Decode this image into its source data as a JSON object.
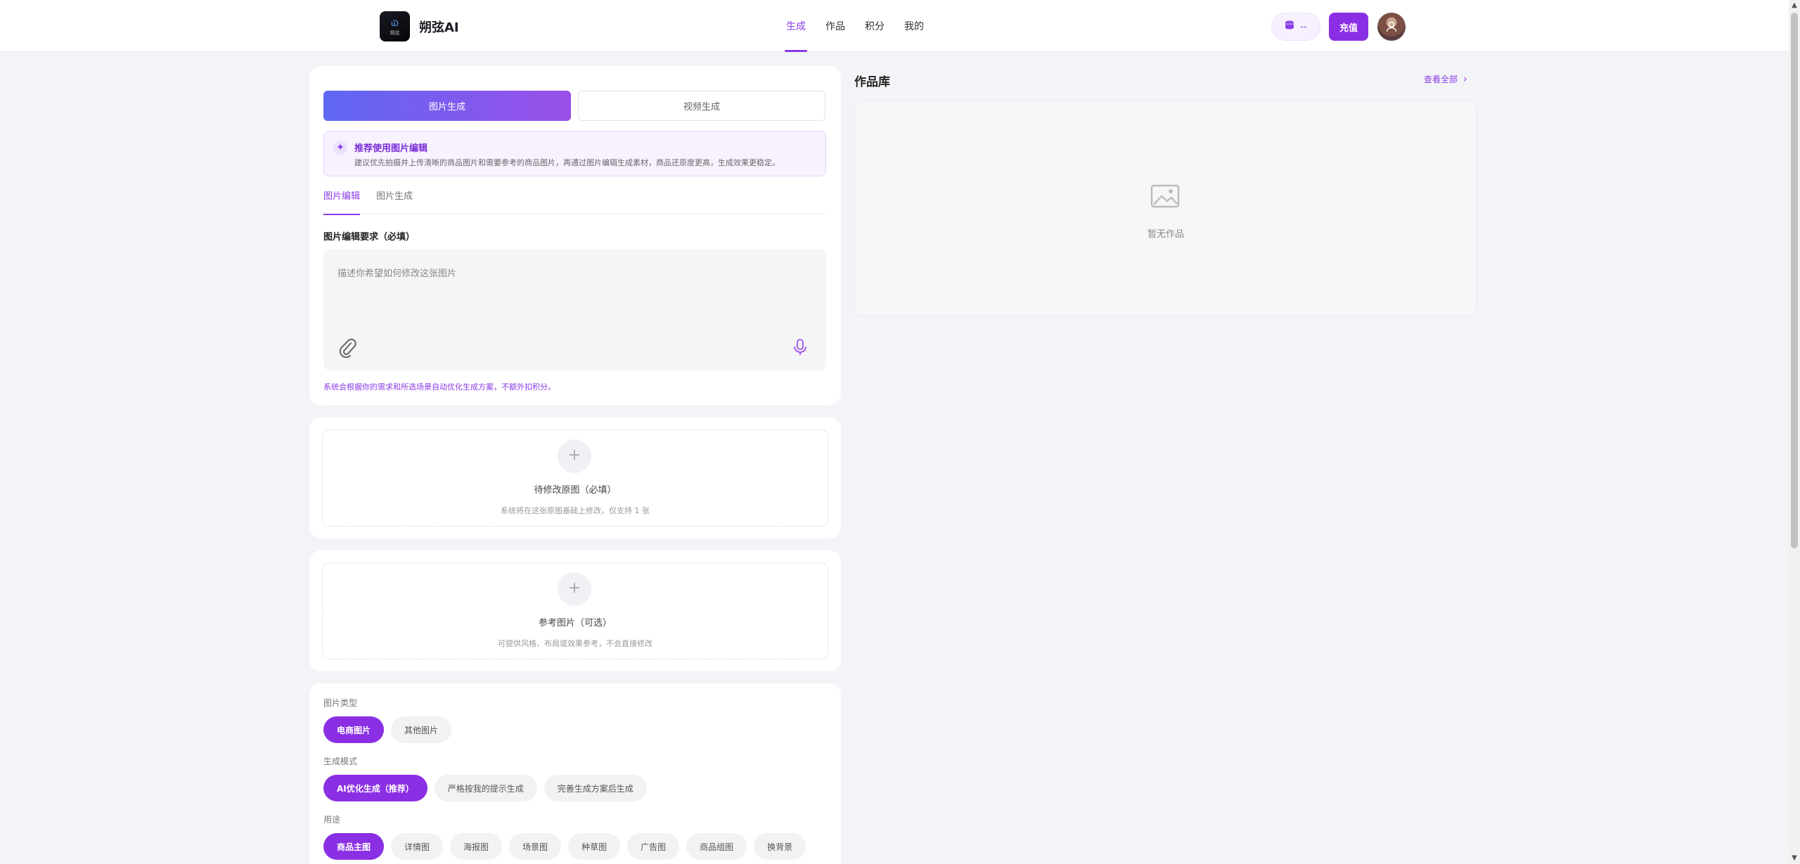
{
  "header": {
    "logo_text": "朔弦",
    "brand": "朔弦AI",
    "nav": [
      "生成",
      "作品",
      "积分",
      "我的"
    ],
    "points": "--",
    "recharge": "充值"
  },
  "generator": {
    "mode_tabs": [
      "图片生成",
      "视频生成"
    ],
    "tip": {
      "title": "推荐使用图片编辑",
      "desc": "建议优先拍摄并上传清晰的商品图片和需要参考的商品图片，再通过图片编辑生成素材，商品还原度更高，生成效果更稳定。"
    },
    "sub_tabs": [
      "图片编辑",
      "图片生成"
    ],
    "field_label": "图片编辑要求（必填）",
    "placeholder": "描述你希望如何修改这张图片",
    "hint": "系统会根据你的需求和所选场景自动优化生成方案，不额外扣积分。"
  },
  "upload_source": {
    "title": "待修改原图（必填）",
    "desc": "系统将在这张原图基础上修改，仅支持 1 张"
  },
  "upload_reference": {
    "title": "参考图片（可选）",
    "desc": "可提供风格、布局或效果参考，不会直接修改"
  },
  "options": {
    "image_type_label": "图片类型",
    "image_types": [
      "电商图片",
      "其他图片"
    ],
    "mode_label": "生成模式",
    "modes": [
      "AI优化生成（推荐）",
      "严格按我的提示生成",
      "完善生成方案后生成"
    ],
    "usage_label": "用途",
    "usages": [
      "商品主图",
      "详情图",
      "海报图",
      "场景图",
      "种草图",
      "广告图",
      "商品组图",
      "换背景"
    ]
  },
  "library": {
    "title": "作品库",
    "view_all": "查看全部",
    "empty": "暂无作品"
  },
  "colors": {
    "accent": "#8a2fe3",
    "gradient_start": "#5f68f2",
    "gradient_end": "#9a4fe9"
  }
}
